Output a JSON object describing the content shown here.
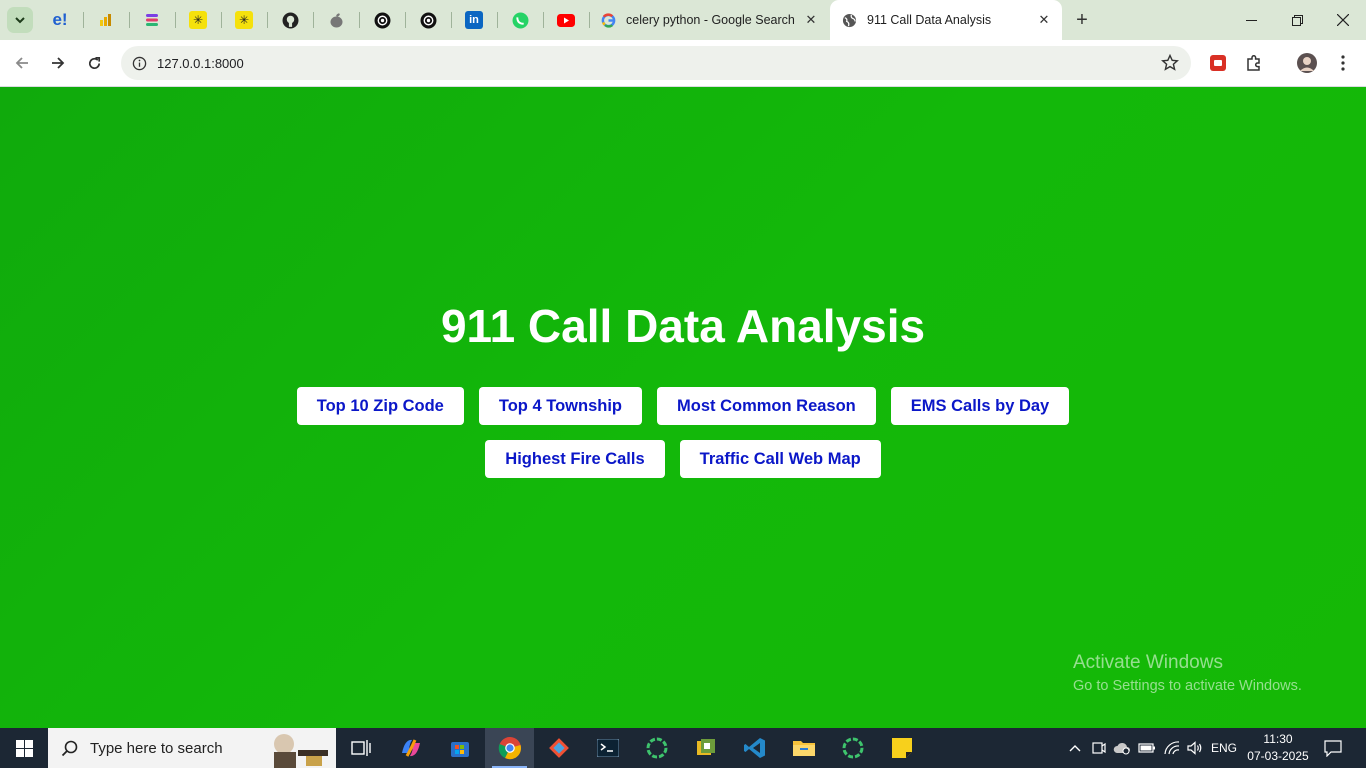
{
  "browser": {
    "tabs": [
      {
        "title": "celery python - Google Search",
        "icon": "google-icon"
      },
      {
        "title": "911 Call Data Analysis",
        "icon": "globe-icon",
        "active": true
      }
    ],
    "pinned_tabs": [
      "edge-e-icon",
      "powerbi-icon",
      "stacked-logo-icon",
      "yellow-star-icon",
      "yellow-star-icon",
      "github-icon",
      "apple-icon",
      "openai-icon",
      "openai-icon",
      "linkedin-icon",
      "whatsapp-icon",
      "youtube-icon"
    ],
    "pinned_labels": {
      "edge": "e!",
      "linkedin": "in"
    },
    "address": "127.0.0.1:8000",
    "close_glyph": "✕",
    "new_tab_glyph": "+"
  },
  "page": {
    "title": "911 Call Data Analysis",
    "buttons_row1": [
      "Top 10 Zip Code",
      "Top 4 Township",
      "Most Common Reason",
      "EMS Calls by Day"
    ],
    "buttons_row2": [
      "Highest Fire Calls",
      "Traffic Call Web Map"
    ],
    "background_color": "#13b30a",
    "button_text_color": "#0b17c8"
  },
  "watermark": {
    "line1": "Activate Windows",
    "line2": "Go to Settings to activate Windows."
  },
  "taskbar": {
    "search_placeholder": "Type here to search",
    "language": "ENG",
    "time": "11:30",
    "date": "07-03-2025"
  }
}
